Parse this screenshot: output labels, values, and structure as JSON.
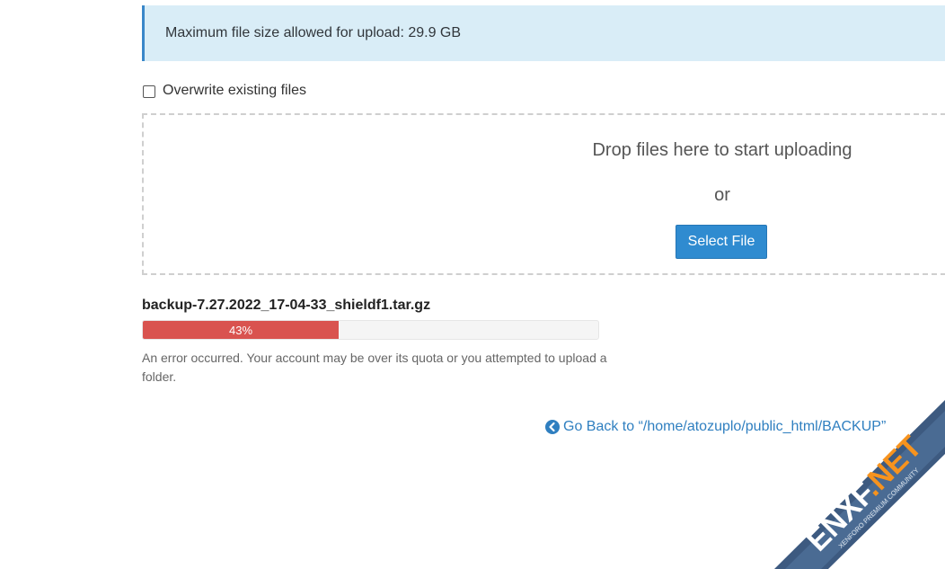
{
  "info": {
    "max_upload_text": "Maximum file size allowed for upload: 29.9 GB"
  },
  "options": {
    "overwrite_label": "Overwrite existing files",
    "overwrite_checked": false
  },
  "dropzone": {
    "prompt": "Drop files here to start uploading",
    "or_text": "or",
    "select_button": "Select File"
  },
  "upload": {
    "file_name": "backup-7.27.2022_17-04-33_shieldf1.tar.gz",
    "progress_percent": 43,
    "progress_label": "43%",
    "status_color": "#d9534f",
    "error_message": "An error occurred. Your account may be over its quota or you attempted to upload a folder."
  },
  "navigation": {
    "go_back_label": "Go Back to “/home/atozuplo/public_html/BACKUP”",
    "go_back_icon": "arrow-circle-left-icon"
  },
  "watermark": {
    "brand": "ENXF.NET",
    "tagline": "XENFORO PREMIUM COMMUNITY"
  },
  "colors": {
    "accent": "#2f8bd0",
    "info_bg": "#d9edf7",
    "error": "#d9534f",
    "link": "#2f7fc0"
  }
}
